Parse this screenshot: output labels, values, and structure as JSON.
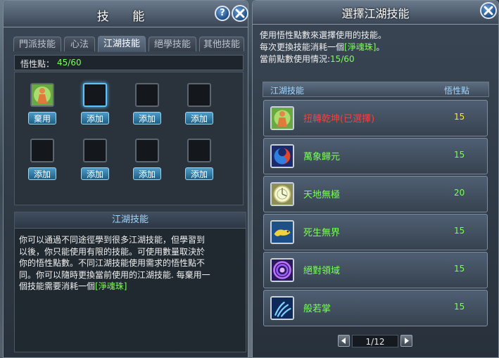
{
  "left_window": {
    "title": "技 能",
    "help_label": "?",
    "tabs": [
      {
        "label": "門派技能",
        "active": false
      },
      {
        "label": "心法",
        "active": false
      },
      {
        "label": "江湖技能",
        "active": true
      },
      {
        "label": "絕學技能",
        "active": false
      },
      {
        "label": "其他技能",
        "active": false
      }
    ],
    "points_label": "悟性點：",
    "points_value": "45/60",
    "slots": [
      {
        "button": "棄用",
        "filled": true,
        "selected": false,
        "icon": "monk-skill-icon"
      },
      {
        "button": "添加",
        "filled": false,
        "selected": true
      },
      {
        "button": "添加",
        "filled": false,
        "selected": false
      },
      {
        "button": "添加",
        "filled": false,
        "selected": false
      },
      {
        "button": "添加",
        "filled": false,
        "selected": false
      },
      {
        "button": "添加",
        "filled": false,
        "selected": false
      },
      {
        "button": "添加",
        "filled": false,
        "selected": false
      },
      {
        "button": "添加",
        "filled": false,
        "selected": false
      }
    ],
    "description": {
      "header": "江湖技能",
      "lines": [
        "你可以通過不同途徑學到很多江湖技能，但學習到",
        "以後，你只能使用有限的技能。可使用數量取決於",
        "你的悟性點數。不同江湖技能使用需求的悟性點不",
        "同。你可以隨時更換當前使用的江湖技能. 每棄用一"
      ],
      "last_line_prefix": "個技能需要消耗一個",
      "last_line_item": "[淨魂珠]"
    }
  },
  "right_window": {
    "title": "選擇江湖技能",
    "info": {
      "line1": "使用悟性點數來選擇使用的技能。",
      "line2_prefix": "每次更換技能消耗一個",
      "line2_item": "[淨魂珠]",
      "line2_suffix": "。",
      "line3_prefix": "當前點數使用情況:",
      "line3_value": "15/60"
    },
    "columns": {
      "skill": "江湖技能",
      "points": "悟性點"
    },
    "skills": [
      {
        "name": "扭轉乾坤(已選擇)",
        "points": "15",
        "selected": true,
        "icon": "monk-skill-icon"
      },
      {
        "name": "萬象歸元",
        "points": "15",
        "selected": false,
        "icon": "swirl-red-blue-icon"
      },
      {
        "name": "天地無極",
        "points": "20",
        "selected": false,
        "icon": "clock-disc-icon"
      },
      {
        "name": "死生無界",
        "points": "15",
        "selected": false,
        "icon": "golden-dragon-icon"
      },
      {
        "name": "絕對領域",
        "points": "15",
        "selected": false,
        "icon": "purple-vortex-icon"
      },
      {
        "name": "般若掌",
        "points": "15",
        "selected": false,
        "icon": "blue-claw-icon"
      }
    ],
    "pager": {
      "text": "1/12"
    }
  },
  "colors": {
    "accent_green": "#7dff5a",
    "selected_red": "#ff3b3b",
    "points_yellow": "#ffe34a",
    "header_blue": "#9fd6ff"
  }
}
